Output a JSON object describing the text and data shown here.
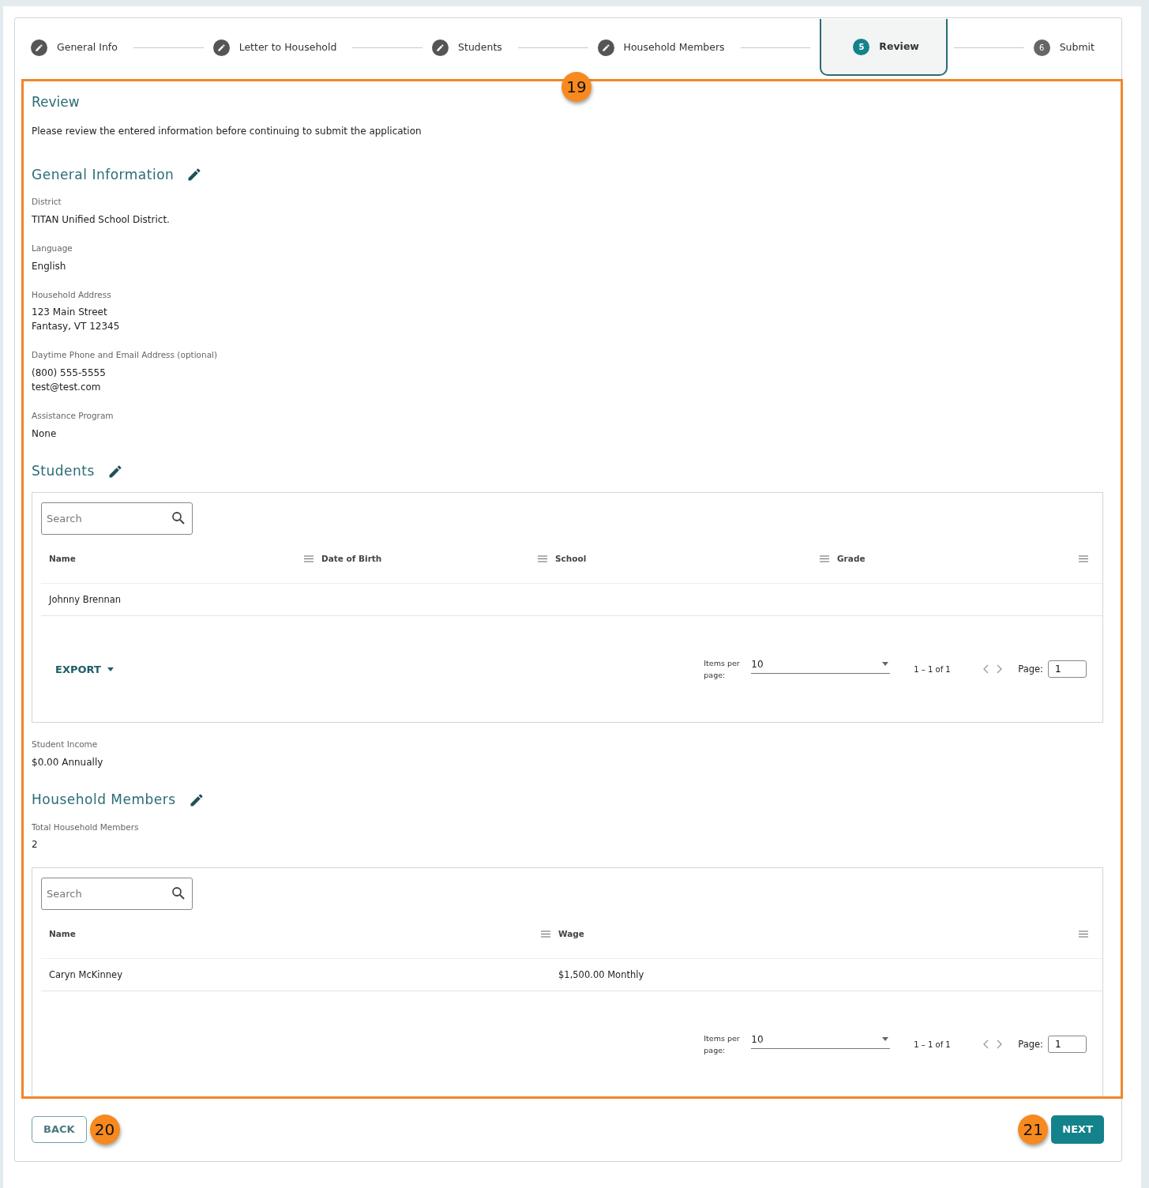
{
  "steps": [
    {
      "label": "General Info",
      "completed": true,
      "selected": false
    },
    {
      "label": "Letter to Household",
      "completed": true,
      "selected": false
    },
    {
      "label": "Students",
      "completed": true,
      "selected": false
    },
    {
      "label": "Household Members",
      "completed": true,
      "selected": false
    },
    {
      "label": "Review",
      "number": "5",
      "completed": false,
      "selected": true
    },
    {
      "label": "Submit",
      "number": "6",
      "completed": false,
      "selected": false
    }
  ],
  "review": {
    "title": "Review",
    "intro": "Please review the entered information before continuing to submit the application"
  },
  "sections": [
    {
      "kind": "fields",
      "title": "General Information",
      "fields": [
        {
          "label": "District",
          "lines": [
            "TITAN Unified School District."
          ]
        },
        {
          "label": "Language",
          "lines": [
            "English"
          ]
        },
        {
          "label": "Household Address",
          "lines": [
            "123 Main Street",
            "Fantasy, VT 12345"
          ]
        },
        {
          "label": "Daytime Phone and Email Address (optional)",
          "lines": [
            "(800) 555-5555",
            "test@test.com"
          ]
        },
        {
          "label": "Assistance Program",
          "lines": [
            "None"
          ]
        }
      ]
    },
    {
      "kind": "table",
      "title": "Students",
      "table": {
        "search_placeholder": "Search",
        "columns": [
          "Name",
          "Date of Birth",
          "School",
          "Grade"
        ],
        "rows": [
          [
            "Johnny Brennan",
            "",
            "",
            ""
          ]
        ],
        "export": "EXPORT",
        "items_per_page_label": "Items per page:",
        "items_per_page": "10",
        "range": "1 – 1 of 1",
        "page_label": "Page:",
        "page": "1"
      },
      "fields": [
        {
          "label": "Student Income",
          "lines": [
            "$0.00 Annually"
          ]
        }
      ]
    },
    {
      "kind": "table",
      "title": "Household Members",
      "fields_before": [
        {
          "label": "Total Household Members",
          "lines": [
            "2"
          ]
        }
      ],
      "table": {
        "search_placeholder": "Search",
        "columns": [
          "Name",
          "Wage"
        ],
        "rows": [
          [
            "Caryn McKinney",
            "$1,500.00 Monthly"
          ]
        ],
        "items_per_page_label": "Items per page:",
        "items_per_page": "10",
        "range": "1 – 1 of 1",
        "page_label": "Page:",
        "page": "1"
      }
    }
  ],
  "buttons": {
    "back": "BACK",
    "next": "NEXT"
  },
  "callouts": [
    "19",
    "20",
    "21"
  ]
}
